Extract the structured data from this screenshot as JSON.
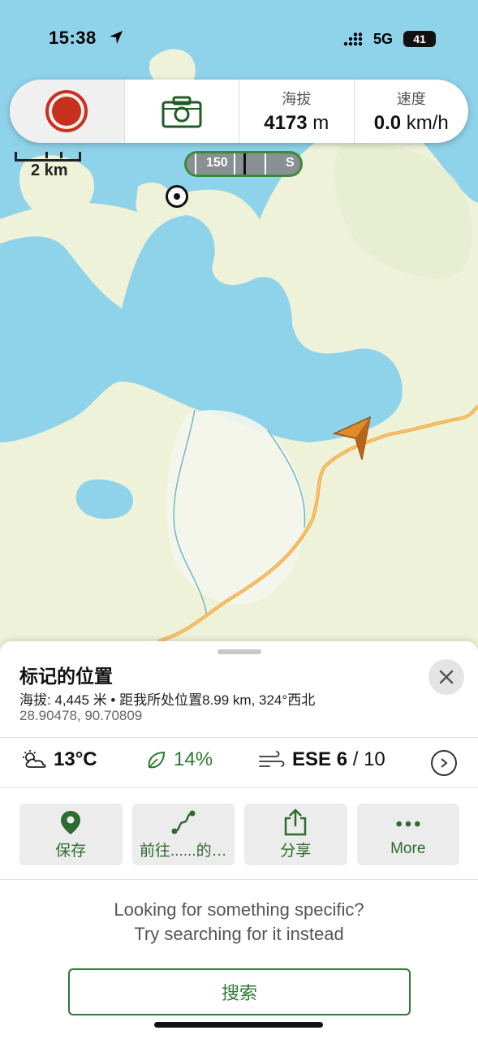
{
  "status_bar": {
    "time": "15:38",
    "network": "5G",
    "battery": "41"
  },
  "toolbar": {
    "altitude_label": "海拔",
    "altitude_value": "4173",
    "altitude_unit": "m",
    "speed_label": "速度",
    "speed_value": "0.0",
    "speed_unit": "km/h"
  },
  "map": {
    "scale_label": "2 km",
    "compass_degrees": "150",
    "compass_direction": "S"
  },
  "place": {
    "title": "标记的位置",
    "subtitle": "海拔: 4,445 米 • 距我所处位置8.99 km, 324°西北",
    "coordinates": "28.90478, 90.70809"
  },
  "weather": {
    "temperature": "13°C",
    "humidity": "14%",
    "wind_direction": "ESE",
    "wind_speed": "6",
    "wind_separator": " / ",
    "wind_gust": "10"
  },
  "actions": [
    {
      "label": "保存",
      "icon": "map-pin-icon"
    },
    {
      "label": "前往......的…",
      "icon": "route-icon"
    },
    {
      "label": "分享",
      "icon": "share-icon"
    },
    {
      "label": "More",
      "icon": "more-icon"
    }
  ],
  "hint": {
    "line1": "Looking for something specific?",
    "line2": "Try searching for it instead"
  },
  "search_button": "搜索",
  "colors": {
    "accent_green": "#2d7a32",
    "record_red": "#c8311c",
    "water": "#8fd3ea",
    "land": "#eef2d8",
    "road": "#f2a93b"
  }
}
